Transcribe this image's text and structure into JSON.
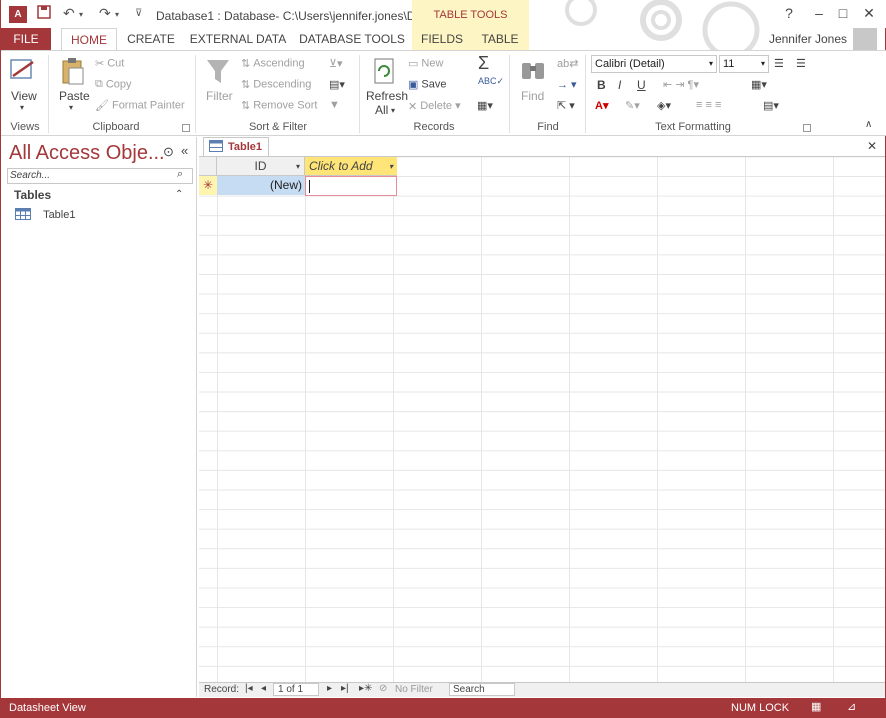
{
  "titlebar": {
    "app_icon": "A",
    "title": "Database1 : Database- C:\\Users\\jennifer.jones\\D...",
    "contextual_tab_group": "TABLE TOOLS",
    "help": "?",
    "minimize": "–",
    "restore": "□",
    "close": "✕"
  },
  "tabs": [
    "FILE",
    "HOME",
    "CREATE",
    "EXTERNAL DATA",
    "DATABASE TOOLS",
    "FIELDS",
    "TABLE"
  ],
  "user": {
    "name": "Jennifer Jones"
  },
  "ribbon": {
    "views": {
      "label": "Views",
      "view": "View"
    },
    "clipboard": {
      "label": "Clipboard",
      "paste": "Paste",
      "cut": "Cut",
      "copy": "Copy",
      "format_painter": "Format Painter"
    },
    "sort_filter": {
      "label": "Sort & Filter",
      "filter": "Filter",
      "ascending": "Ascending",
      "descending": "Descending",
      "remove_sort": "Remove Sort"
    },
    "records": {
      "label": "Records",
      "refresh": "Refresh",
      "refresh_all": "All",
      "new": "New",
      "save": "Save",
      "delete": "Delete"
    },
    "find": {
      "label": "Find",
      "find": "Find"
    },
    "text_formatting": {
      "label": "Text Formatting",
      "font": "Calibri (Detail)",
      "size": "11",
      "bold": "B",
      "italic": "I",
      "underline": "U"
    }
  },
  "nav": {
    "title": "All Access Obje...",
    "search_placeholder": "Search...",
    "group": "Tables",
    "items": [
      "Table1"
    ]
  },
  "doc": {
    "tab": "Table1",
    "columns": [
      "ID",
      "Click to Add"
    ],
    "new_row": "(New)",
    "record_nav": {
      "label": "Record:",
      "position": "1 of 1",
      "filter": "No Filter",
      "search": "Search"
    }
  },
  "status": {
    "view": "Datasheet View",
    "numlock": "NUM LOCK"
  },
  "colors": {
    "accent": "#a4373a",
    "tabletools": "#fdf5c3",
    "click_to_add": "#ffe477",
    "selected_cell": "#c6dcf2"
  }
}
